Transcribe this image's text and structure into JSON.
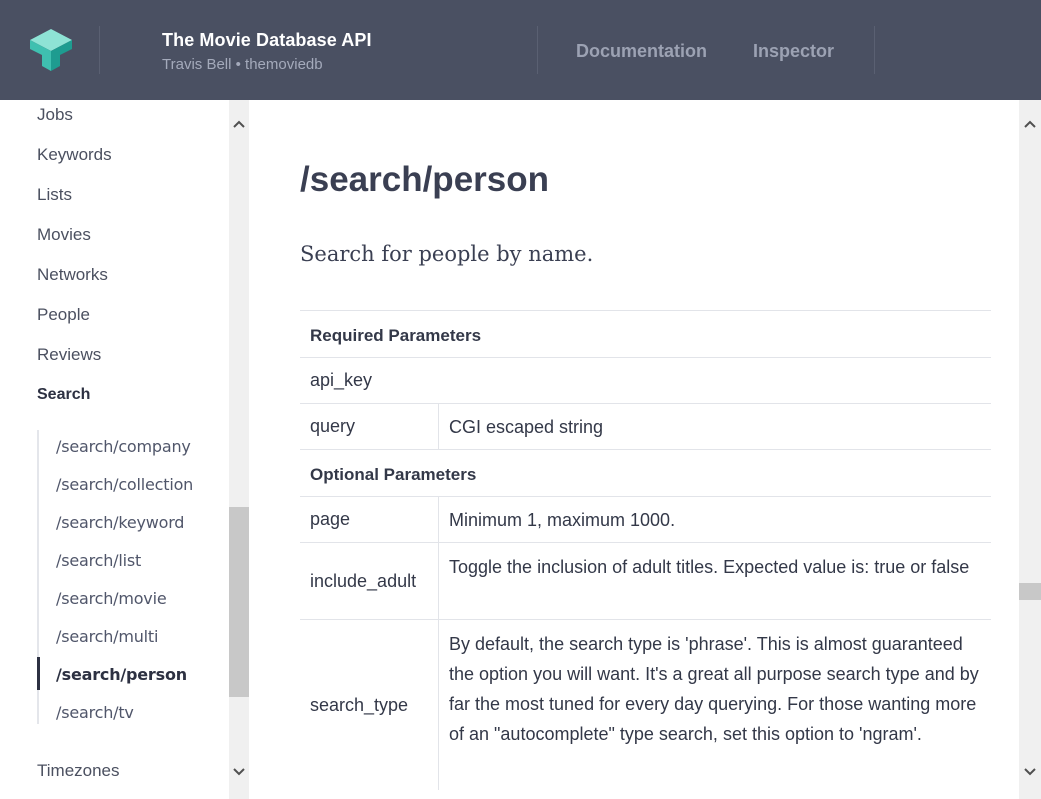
{
  "header": {
    "title": "The Movie Database API",
    "subtitle": "Travis Bell • themoviedb",
    "nav": {
      "documentation": "Documentation",
      "inspector": "Inspector"
    }
  },
  "sidebar": {
    "items": [
      "Jobs",
      "Keywords",
      "Lists",
      "Movies",
      "Networks",
      "People",
      "Reviews",
      "Search"
    ],
    "active": "Search",
    "subitems": [
      "/search/company",
      "/search/collection",
      "/search/keyword",
      "/search/list",
      "/search/movie",
      "/search/multi",
      "/search/person",
      "/search/tv"
    ],
    "active_subitem": "/search/person",
    "after": "Timezones"
  },
  "main": {
    "title": "/search/person",
    "description": "Search for people by name.",
    "required_title": "Required Parameters",
    "required": [
      {
        "name": "api_key",
        "desc": ""
      },
      {
        "name": "query",
        "desc": "CGI escaped string"
      }
    ],
    "optional_title": "Optional Parameters",
    "optional": [
      {
        "name": "page",
        "desc": "Minimum 1, maximum 1000."
      },
      {
        "name": "include_adult",
        "desc": "Toggle the inclusion of adult titles. Expected value is: true or false"
      },
      {
        "name": "search_type",
        "desc": "By default, the search type is 'phrase'. This is almost guaranteed the option you will want. It's a great all purpose search type and by far the most tuned for every day querying. For those wanting more of an \"autocomplete\" type search, set this option to 'ngram'."
      }
    ]
  },
  "colors": {
    "header_bg": "#4a5062",
    "logo_light": "#8ee3d5",
    "logo_mid": "#3fc0b0",
    "logo_dark": "#1e9c90"
  }
}
